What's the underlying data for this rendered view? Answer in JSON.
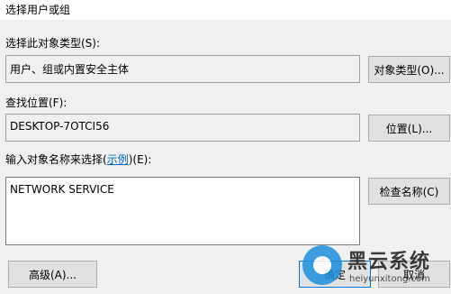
{
  "window": {
    "title": "选择用户或组"
  },
  "object_types": {
    "label": "选择此对象类型(S):",
    "value": "用户、组或内置安全主体",
    "button": "对象类型(O)..."
  },
  "location": {
    "label": "查找位置(F):",
    "value": "DESKTOP-7OTCI56",
    "button": "位置(L)..."
  },
  "names": {
    "label_prefix": "输入对象名称来选择(",
    "label_link": "示例",
    "label_suffix": ")(E):",
    "value": "NETWORK SERVICE",
    "button": "检查名称(C)"
  },
  "footer": {
    "advanced": "高级(A)...",
    "ok": "确定",
    "cancel": "取消"
  },
  "watermark": {
    "brand": "黑云系统",
    "url": "heiyunxitong.com"
  }
}
